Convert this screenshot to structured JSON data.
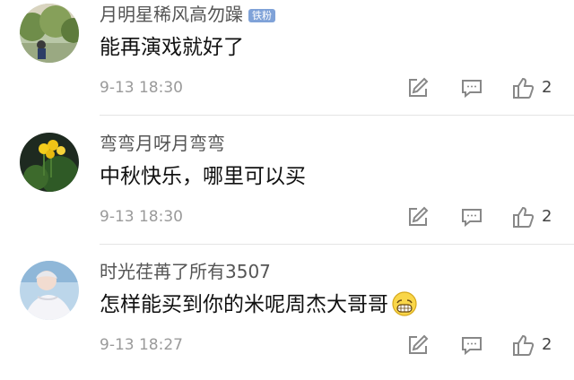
{
  "comments": [
    {
      "username": "月明星稀风高勿躁",
      "badge": "铁粉",
      "text": "能再演戏就好了",
      "time": "9-13 18:30",
      "likes": "2",
      "avatar_icon": "avatar-landscape-trees",
      "emoji_icon": ""
    },
    {
      "username": "弯弯月呀月弯弯",
      "badge": "",
      "text": "中秋快乐，哪里可以买",
      "time": "9-13 18:30",
      "likes": "2",
      "avatar_icon": "avatar-yellow-flowers",
      "emoji_icon": ""
    },
    {
      "username": "时光荏苒了所有3507",
      "badge": "",
      "text": "怎样能买到你的米呢周杰大哥哥",
      "time": "9-13 18:27",
      "likes": "2",
      "avatar_icon": "avatar-person-photo",
      "emoji_icon": "grinning-face-icon"
    }
  ],
  "icons": {
    "edit": "edit-icon",
    "reply": "comment-icon",
    "like": "thumbs-up-icon"
  },
  "colors": {
    "username": "#555555",
    "text": "#111111",
    "meta": "#9a9a9a",
    "badge": "#7fa2d8",
    "icon": "#888888"
  }
}
